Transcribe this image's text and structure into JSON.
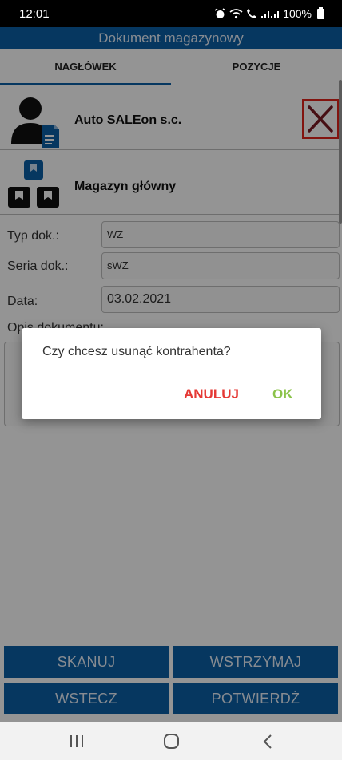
{
  "status_bar": {
    "time": "12:01",
    "icons": [
      "alarm-icon",
      "wifi-icon",
      "call-icon",
      "signal-icon"
    ],
    "battery": "100%"
  },
  "app_bar": {
    "title": "Dokument magazynowy",
    "color": "#0b5fa5"
  },
  "tabs": [
    {
      "label": "NAGŁÓWEK",
      "active": true
    },
    {
      "label": "POZYCJE",
      "active": false
    }
  ],
  "client": {
    "name": "Auto SALEon s.c.",
    "icon": "person-document-icon",
    "delete_icon": "close-icon"
  },
  "warehouse": {
    "name": "Magazyn główny",
    "icon": "warehouse-boxes-icon"
  },
  "form": {
    "doc_type": {
      "label": "Typ dok.:",
      "value": "WZ"
    },
    "series": {
      "label": "Seria dok.:",
      "value": "sWZ"
    },
    "date": {
      "label": "Data:",
      "value": "03.02.2021"
    },
    "description": {
      "label": "Opis dokumentu:",
      "value": ""
    }
  },
  "buttons": {
    "scan": "SKANUJ",
    "hold": "WSTRZYMAJ",
    "back": "WSTECZ",
    "confirm": "POTWIERDŹ"
  },
  "dialog": {
    "message": "Czy chcesz usunąć kontrahenta?",
    "cancel_label": "ANULUJ",
    "ok_label": "OK",
    "cancel_color": "#e53935",
    "ok_color": "#8bc34a"
  },
  "nav_bar": {
    "icons": [
      "recents-icon",
      "home-icon",
      "back-icon"
    ]
  }
}
